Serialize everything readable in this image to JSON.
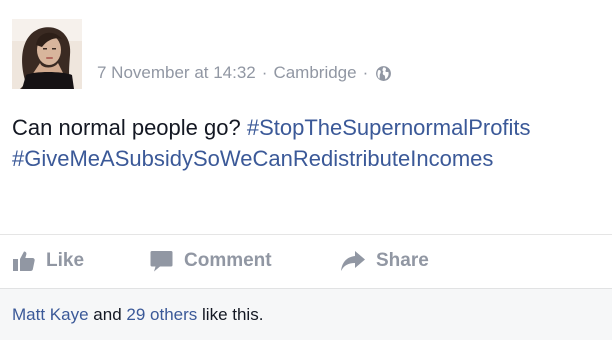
{
  "post": {
    "author_avatar": "profile-photo",
    "timestamp": "7 November at 14:32",
    "separator": "·",
    "location": "Cambridge",
    "privacy_icon": "globe-icon",
    "text_plain": "Can normal people go?",
    "hashtags": [
      "#StopTheSupernormalProfits",
      "#GiveMeASubsidySoWeCanRedistributeIncomes"
    ]
  },
  "actions": {
    "like": {
      "label": "Like",
      "icon": "thumbs-up-icon"
    },
    "comment": {
      "label": "Comment",
      "icon": "comment-bubble-icon"
    },
    "share": {
      "label": "Share",
      "icon": "share-arrow-icon"
    }
  },
  "likes_summary": {
    "first_liker": "Matt Kaye",
    "conjunction": "and",
    "others_link": "29 others",
    "suffix": "like this."
  },
  "colors": {
    "link": "#3b5998",
    "meta": "#9197a3",
    "text": "#141823",
    "summary_bg": "#f6f7f8"
  }
}
